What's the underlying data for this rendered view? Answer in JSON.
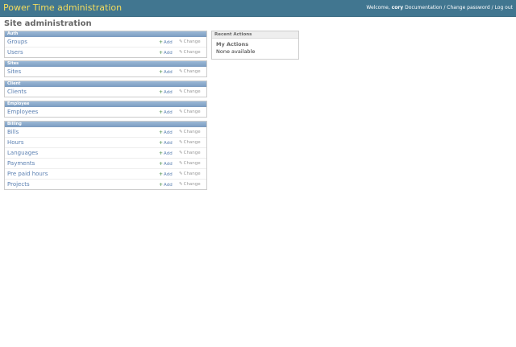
{
  "header": {
    "branding": "Power Time administration",
    "welcome": "Welcome,",
    "username": "cory",
    "documentation": "Documentation",
    "change_password": "Change password",
    "log_out": "Log out",
    "separator": "/"
  },
  "page_title": "Site administration",
  "labels": {
    "add": "Add",
    "change": "Change"
  },
  "modules": [
    {
      "caption": "Auth",
      "items": [
        "Groups",
        "Users"
      ]
    },
    {
      "caption": "Sites",
      "items": [
        "Sites"
      ]
    },
    {
      "caption": "Client",
      "items": [
        "Clients"
      ]
    },
    {
      "caption": "Employee",
      "items": [
        "Employees"
      ]
    },
    {
      "caption": "Billing",
      "items": [
        "Bills",
        "Hours",
        "Languages",
        "Payments",
        "Pre paid hours",
        "Projects"
      ]
    }
  ],
  "recent_actions": {
    "title": "Recent Actions",
    "subtitle": "My Actions",
    "empty": "None available"
  },
  "colors": {
    "header_bg": "#417690",
    "branding": "#f5dd5d",
    "caption_bg": "#7ca0c7",
    "link": "#5b80b2"
  },
  "icons": {
    "add": "plus-icon",
    "change": "pencil-icon"
  }
}
